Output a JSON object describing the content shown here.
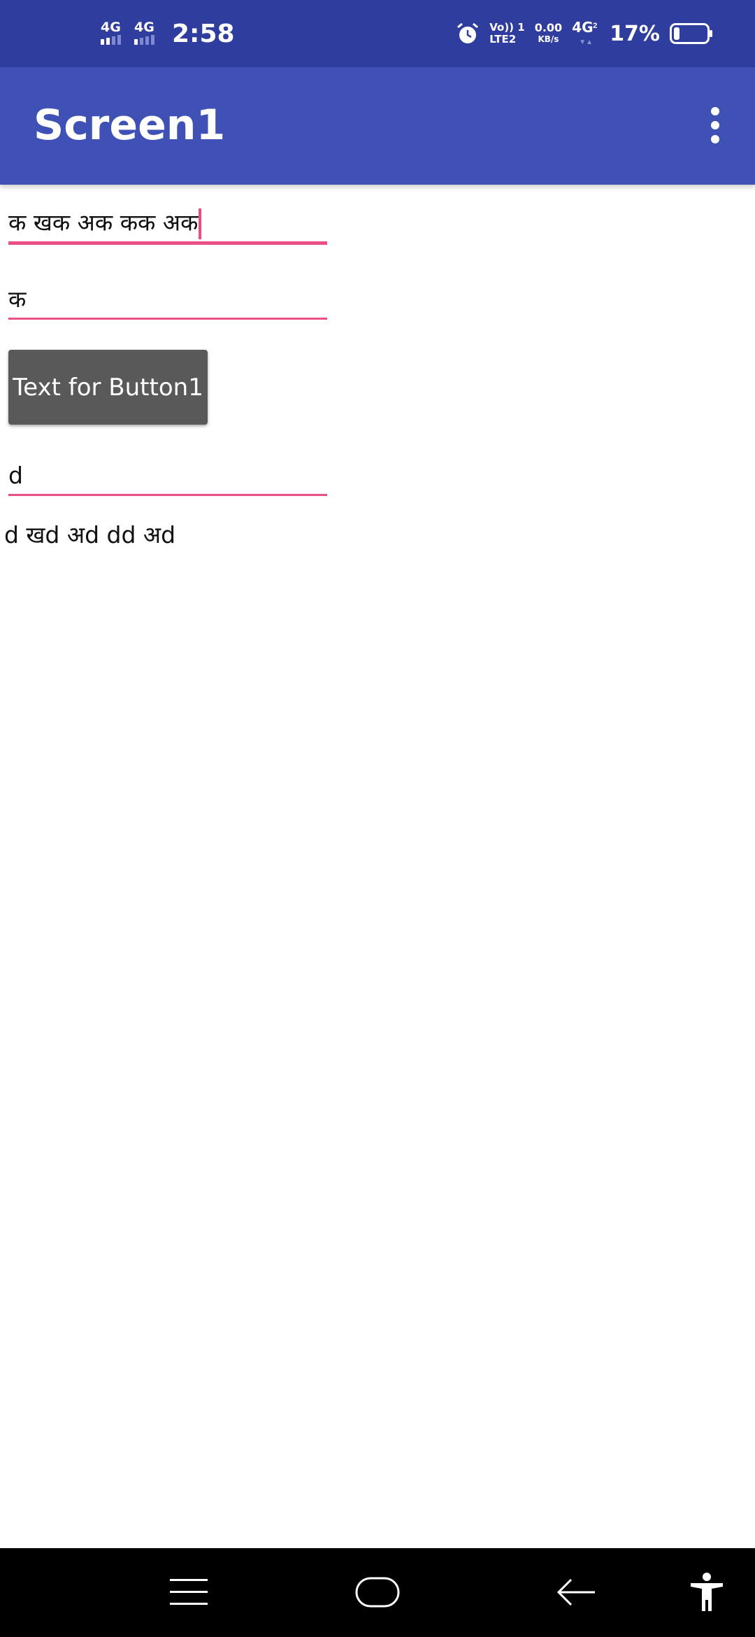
{
  "status_bar": {
    "network_1": "4G",
    "network_2": "4G",
    "time": "2:58",
    "volte_top": "Vo)) 1",
    "volte_bottom": "LTE2",
    "speed_value": "0.00",
    "speed_unit": "KB/s",
    "network_3": "4G",
    "network_3_sub": "2",
    "battery_percent": "17%",
    "battery_level": 0.17,
    "icons": [
      "signal-icon",
      "alarm-icon",
      "battery-icon"
    ]
  },
  "app_bar": {
    "title": "Screen1",
    "overflow_icon": "more-vert-icon"
  },
  "form": {
    "textbox1_value": "क खक अक कक अक",
    "textbox2_value": "क",
    "button1_label": "Text for Button1",
    "textbox3_value": "d",
    "label1_text": "d खd अd dd अd"
  },
  "nav_bar": {
    "icons": [
      "menu-icon",
      "home-icon",
      "back-icon",
      "accessibility-icon"
    ]
  },
  "colors": {
    "status_bar": "#2f3e9e",
    "app_bar": "#3f51b5",
    "accent": "#e94e87",
    "button": "#595959",
    "nav_bar": "#000000"
  }
}
